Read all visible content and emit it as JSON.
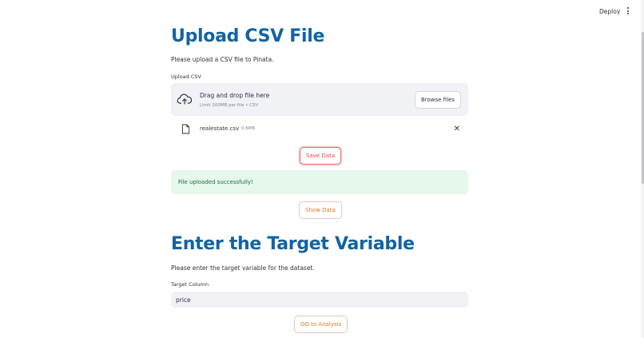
{
  "toolbar": {
    "deploy_label": "Deploy"
  },
  "upload_section": {
    "title": "Upload CSV File",
    "description": "Please upload a CSV file to Pinata.",
    "field_label": "Upload CSV",
    "dropzone": {
      "text": "Drag and drop file here",
      "subtext": "Limit 200MB per file • CSV",
      "browse_label": "Browse files"
    },
    "file": {
      "name": "realestate.csv",
      "size": "0.6MB"
    },
    "save_label": "Save Data",
    "success_message": "File uploaded successfully!",
    "show_label": "Show Data"
  },
  "target_section": {
    "title": "Enter the Target Variable",
    "description": "Please enter the target variable for the dataset.",
    "field_label": "Target Column",
    "value": "price",
    "go_label": "GO to Analysis"
  },
  "colors": {
    "heading": "#1263a3",
    "accent": "#e8731c",
    "success_bg": "#e6f7ec",
    "success_text": "#177233",
    "input_bg": "#f0f2f6"
  }
}
